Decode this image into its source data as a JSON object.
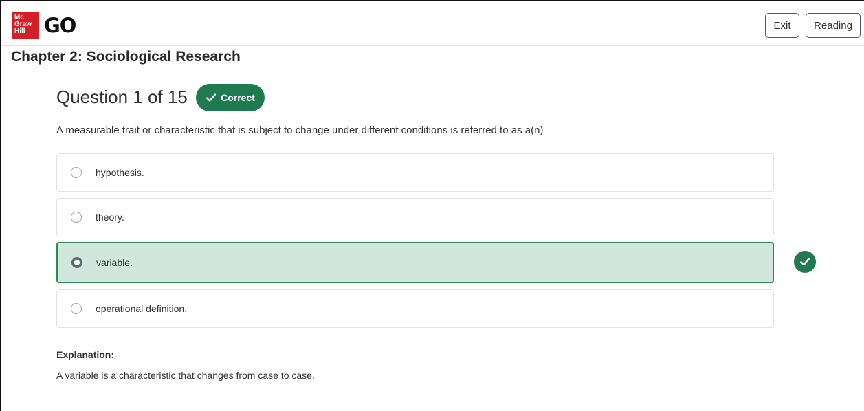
{
  "header": {
    "logo_lines": [
      "Mc",
      "Graw",
      "Hill"
    ],
    "brand": "GO",
    "exit_label": "Exit",
    "reading_label": "Reading"
  },
  "chapter_title": "Chapter 2: Sociological Research",
  "question": {
    "title": "Question 1 of 15",
    "status_badge": "Correct",
    "prompt": "A measurable trait or characteristic that is subject to change under different conditions is referred to as a(n)",
    "choices": [
      {
        "label": "hypothesis.",
        "selected": false
      },
      {
        "label": "theory.",
        "selected": false
      },
      {
        "label": "variable.",
        "selected": true,
        "correct": true
      },
      {
        "label": "operational definition.",
        "selected": false
      }
    ]
  },
  "explanation": {
    "heading": "Explanation:",
    "text": "A variable is a characteristic that changes from case to case."
  },
  "colors": {
    "brand_red": "#d51f26",
    "correct_green": "#1f7a50",
    "selected_bg": "#d1e7dd",
    "selected_border": "#2e8b57"
  },
  "icons": {
    "badge_icon": "checkmark-icon",
    "correct_mark_icon": "check-circle-icon"
  }
}
